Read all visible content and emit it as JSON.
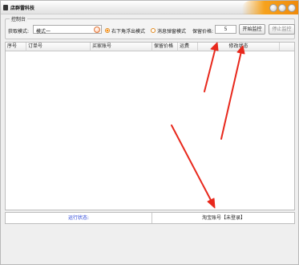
{
  "window": {
    "title": "店群雷科技"
  },
  "control": {
    "group_label": "控制台",
    "mode_label": "获取模式:",
    "mode_value": "模式一",
    "radio1_label": "右下角浮出模式",
    "radio2_label": "消息弹窗模式",
    "price_label": "保留价格:",
    "price_value": "5",
    "start_button": "开始监控",
    "stop_button": "停止监控"
  },
  "table": {
    "columns": [
      "序号",
      "订单号",
      "买家账号",
      "保留价格",
      "运费",
      "修改状态"
    ]
  },
  "status": {
    "left": "运行状态:",
    "right": "淘宝账号【未登录】"
  },
  "colors": {
    "accent_orange": "#f08a0a",
    "status_blue": "#2a44d8",
    "annotation_red": "#e8281c"
  }
}
